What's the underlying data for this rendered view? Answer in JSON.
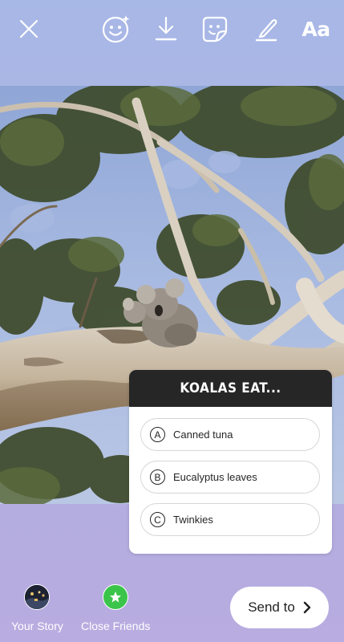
{
  "toolbar": {
    "close_icon": "close-icon",
    "effects_icon": "face-effects-icon",
    "download_icon": "download-icon",
    "sticker_icon": "sticker-icon",
    "draw_icon": "draw-icon",
    "text_label": "Aa"
  },
  "photo": {
    "subject": "koala-photo"
  },
  "quiz": {
    "title": "KOALAS EAT...",
    "options": [
      {
        "letter": "A",
        "text": "Canned tuna"
      },
      {
        "letter": "B",
        "text": "Eucalyptus leaves"
      },
      {
        "letter": "C",
        "text": "Twinkies"
      }
    ]
  },
  "bottom": {
    "your_story_label": "Your Story",
    "close_friends_label": "Close Friends",
    "send_label": "Send to",
    "close_friends_color": "#3bc44a"
  }
}
